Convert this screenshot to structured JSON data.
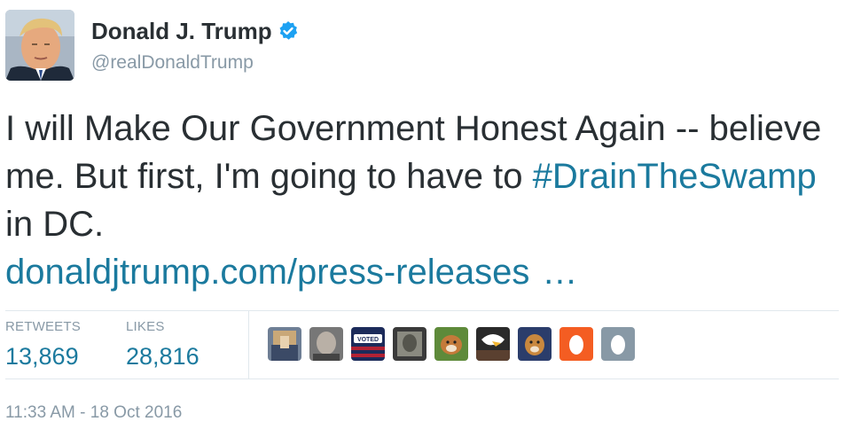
{
  "header": {
    "display_name": "Donald J. Trump",
    "handle": "@realDonaldTrump",
    "verified_icon": "verified-badge-icon"
  },
  "tweet": {
    "text_part1": "I will Make Our Government Honest Again -- believe me. But first, I'm going to have to ",
    "hashtag": "#DrainTheSwamp",
    "text_part2": " in DC.",
    "link": "donaldjtrump.com/press-releases",
    "ellipsis": "…"
  },
  "stats": {
    "retweets_label": "RETWEETS",
    "retweets_value": "13,869",
    "likes_label": "LIKES",
    "likes_value": "28,816"
  },
  "likers": [
    {
      "icon": "liker-avatar-1"
    },
    {
      "icon": "liker-avatar-2"
    },
    {
      "icon": "liker-avatar-voted"
    },
    {
      "icon": "liker-avatar-4"
    },
    {
      "icon": "liker-avatar-dog"
    },
    {
      "icon": "liker-avatar-eagle"
    },
    {
      "icon": "liker-avatar-dog-2"
    },
    {
      "icon": "egg-avatar-orange"
    },
    {
      "icon": "egg-avatar-gray"
    }
  ],
  "timestamp": "11:33 AM - 18 Oct 2016",
  "colors": {
    "link": "#1b7a9e",
    "muted": "#8899a6",
    "text": "#292f33",
    "verified": "#1da1f2"
  }
}
